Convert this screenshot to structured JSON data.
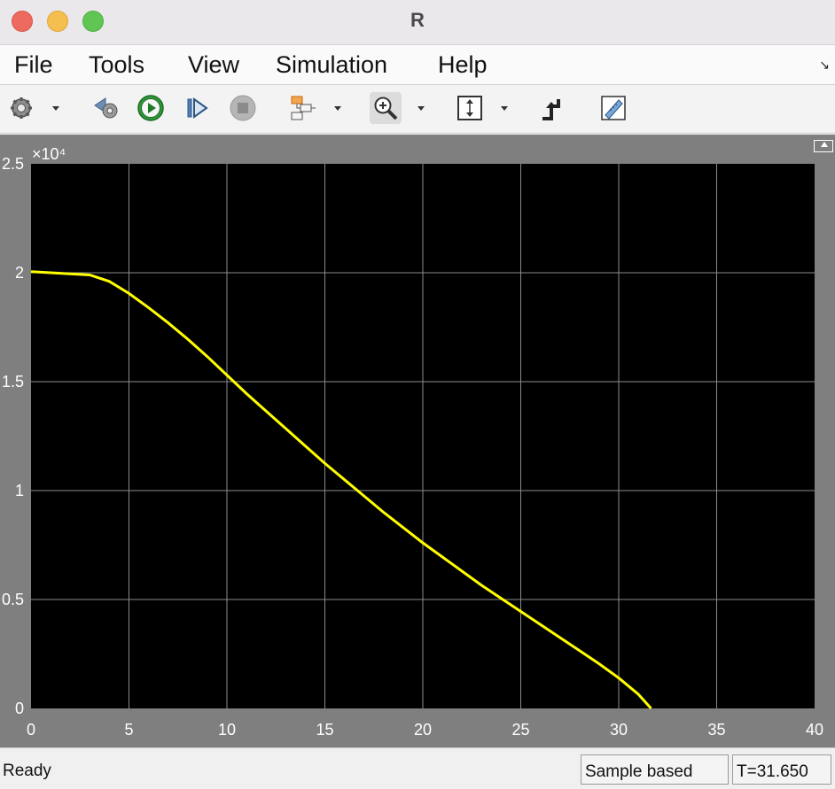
{
  "window": {
    "title": "R"
  },
  "menu": {
    "items": [
      "File",
      "Tools",
      "View",
      "Simulation",
      "Help"
    ]
  },
  "toolbar": {
    "icons": [
      "gear-icon",
      "step-back-icon",
      "run-icon",
      "step-forward-icon",
      "stop-icon",
      "highlight-block-icon",
      "zoom-icon",
      "autoscale-icon",
      "signal-icon",
      "measurement-icon"
    ]
  },
  "chart_data": {
    "type": "line",
    "title": "",
    "xlabel": "",
    "ylabel": "",
    "xlim": [
      0,
      40
    ],
    "ylim": [
      0,
      25000
    ],
    "x_ticks": [
      "0",
      "5",
      "10",
      "15",
      "20",
      "25",
      "30",
      "35",
      "40"
    ],
    "y_ticks": [
      "0",
      "0.5",
      "1",
      "1.5",
      "2",
      "2.5"
    ],
    "y_exponent": "×10⁴",
    "grid": true,
    "background": "#000000",
    "line_color": "#ffff00",
    "series": [
      {
        "x": [
          0,
          1,
          2,
          3,
          4,
          5,
          6,
          7,
          8,
          9,
          10,
          11,
          12,
          13,
          14,
          15,
          16,
          17,
          18,
          19,
          20,
          21,
          22,
          23,
          24,
          25,
          26,
          27,
          28,
          29,
          30,
          31,
          31.65
        ],
        "y": [
          20050,
          20000,
          19950,
          19900,
          19600,
          19050,
          18400,
          17700,
          16950,
          16150,
          15300,
          14450,
          13650,
          12850,
          12050,
          11250,
          10500,
          9750,
          9000,
          8300,
          7600,
          6950,
          6300,
          5650,
          5050,
          4450,
          3850,
          3250,
          2650,
          2050,
          1400,
          650,
          0
        ]
      }
    ]
  },
  "status": {
    "left": "Ready",
    "mode": "Sample based",
    "time": "T=31.650"
  }
}
